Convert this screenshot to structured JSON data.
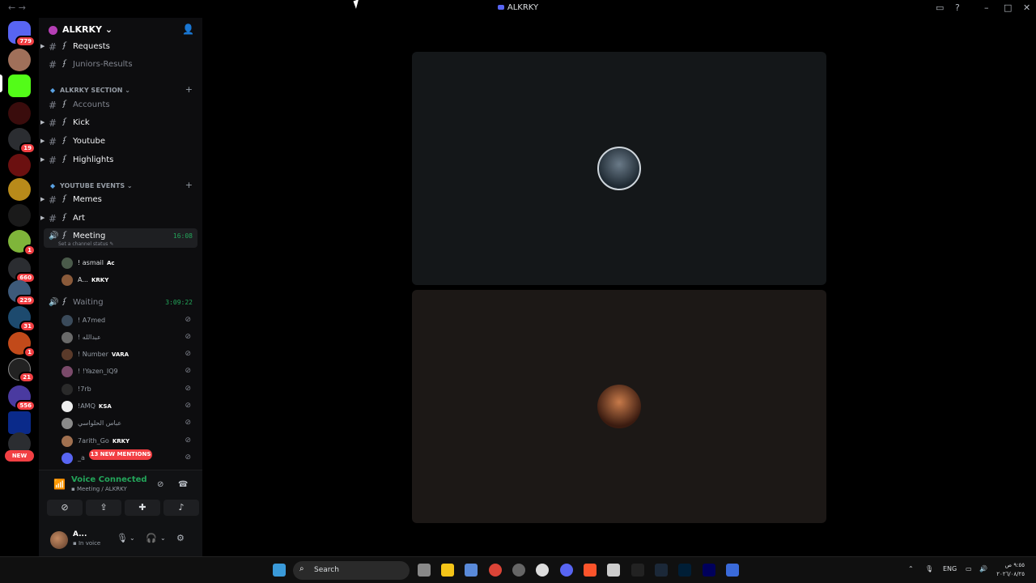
{
  "window": {
    "title": "ALKRKY",
    "back": "←",
    "forward": "→"
  },
  "guild_rail": {
    "badges": [
      "779",
      "19",
      "1",
      "660",
      "229",
      "31",
      "1",
      "21",
      "556"
    ],
    "new_label": "NEW"
  },
  "server": {
    "name": "ALKRKY"
  },
  "channels": {
    "requests": "Requests",
    "juniors_results": "Juniors-Results",
    "category_alkrky": "ALKRKY SECTION",
    "accounts": "Accounts",
    "kick": "Kick",
    "youtube": "Youtube",
    "highlights": "Highlights",
    "category_youtube_events": "YOUTUBE EVENTS",
    "memes": "Memes",
    "art": "Art",
    "meeting": "Meeting",
    "meeting_timer": "16:08",
    "meeting_status": "Set a channel status",
    "waiting": "Waiting",
    "waiting_timer": "3:09:22"
  },
  "meeting_members": [
    {
      "name": "! asmail",
      "tag": "Ac"
    },
    {
      "name": "A...",
      "tag": "KRKY"
    }
  ],
  "waiting_members": [
    {
      "name": "! A7med",
      "tag": ""
    },
    {
      "name": "! عبدالله",
      "tag": ""
    },
    {
      "name": "! Number",
      "tag": "VARA"
    },
    {
      "name": "! !Yazen_IQ9",
      "tag": ""
    },
    {
      "name": "!7rb",
      "tag": ""
    },
    {
      "name": "!AMQ",
      "tag": "KSA"
    },
    {
      "name": "عباس الحلواسي",
      "tag": ""
    },
    {
      "name": "7arith_Go",
      "tag": "KRKY"
    },
    {
      "name": "_a",
      "tag": ""
    }
  ],
  "mentions_pill": "13 NEW MENTIONS",
  "voice_panel": {
    "title": "Voice Connected",
    "subtitle": "Meeting / ALKRKY"
  },
  "user_panel": {
    "name": "A...",
    "status": "In voice"
  },
  "taskbar": {
    "search_label": "Search",
    "language": "ENG",
    "clock_time": "٩:٥٥ ص",
    "clock_date": "٢٠٢٦/٠٨/٢٥"
  },
  "colors": {
    "accent": "#5865f2",
    "voice_green": "#23a55a",
    "mention_red": "#f23f43"
  }
}
